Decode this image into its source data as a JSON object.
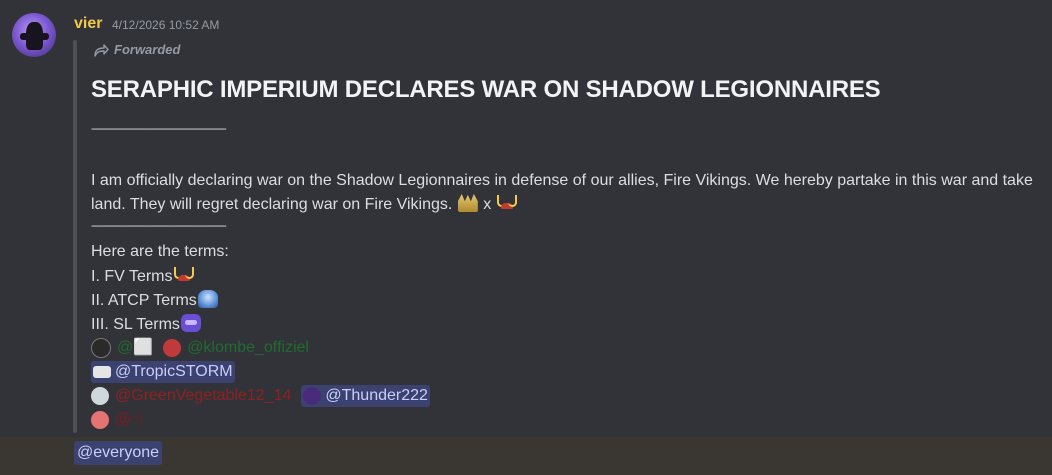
{
  "message": {
    "author": "vier",
    "author_color": "#f0c949",
    "timestamp": "4/12/2026 10:52 AM",
    "forwarded_label": "Forwarded",
    "heading": "SERAPHIC IMPERIUM DECLARES WAR ON SHADOW LEGIONNAIRES",
    "divider": "--------------------------------------------------------------",
    "body": "I am officially declaring war on the Shadow Legionnaires in defense of our allies, Fire Vikings. We hereby partake in this war and take land. They will regret declaring war on Fire Vikings.",
    "body_suffix": "x",
    "terms_intro": "Here are the terms:",
    "terms": [
      {
        "label": "I. FV Terms",
        "emoji": "fire-vikings-horns-emoji"
      },
      {
        "label": "II. ATCP Terms",
        "emoji": "atcp-emoji"
      },
      {
        "label": "III. SL Terms",
        "emoji": "shadow-legion-emoji"
      }
    ],
    "mentions": {
      "row1": [
        "@⬜",
        "@klombe_offiziel"
      ],
      "row2": [
        "@TropicSTORM"
      ],
      "row3": [
        "@GreenVegetable12_14",
        "@Thunder222"
      ],
      "row4": [
        "@☆"
      ]
    },
    "everyone": "@everyone"
  }
}
